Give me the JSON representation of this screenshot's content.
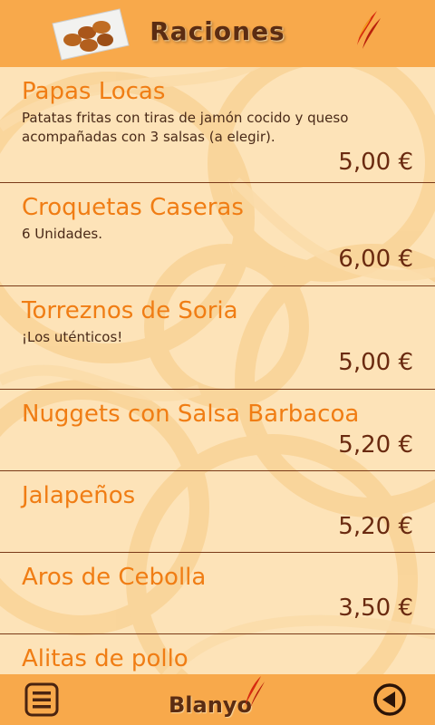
{
  "header": {
    "title": "Raciones",
    "plate_icon": "croquettes-plate-icon",
    "flame_icon": "flame-icon"
  },
  "menu": [
    {
      "name": "Papas Locas",
      "description": "Patatas fritas con tiras de jamón cocido y queso acompañadas con 3 salsas (a elegir).",
      "price": "5,00 €"
    },
    {
      "name": "Croquetas Caseras",
      "description": "6 Unidades.",
      "price": "6,00 €"
    },
    {
      "name": "Torreznos de Soria",
      "description": "¡Los uténticos!",
      "price": "5,00 €"
    },
    {
      "name": "Nuggets con Salsa Barbacoa",
      "description": "",
      "price": "5,20 €"
    },
    {
      "name": "Jalapeños",
      "description": "",
      "price": "5,20 €"
    },
    {
      "name": "Aros de Cebolla",
      "description": "",
      "price": "3,50 €"
    },
    {
      "name": "Alitas de pollo",
      "description": "",
      "price": ""
    }
  ],
  "footer": {
    "brand": "Blanyo",
    "menu_icon": "menu-icon",
    "back_icon": "back-arrow-icon"
  },
  "colors": {
    "bar": "#f8a94b",
    "background": "#fde3b8",
    "item_name": "#f07d14",
    "price": "#6a2a10",
    "divider": "#7a3a18"
  }
}
